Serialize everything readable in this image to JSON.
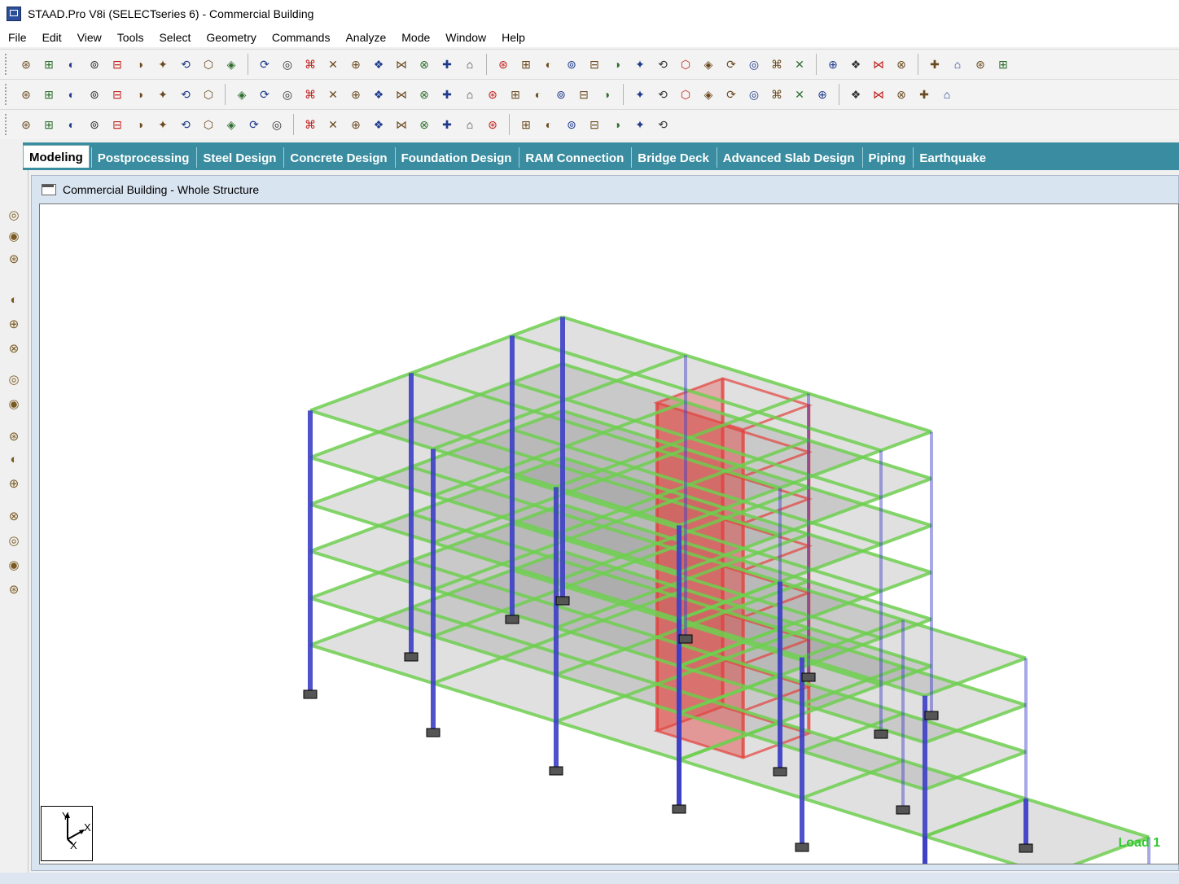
{
  "window": {
    "title": "STAAD.Pro V8i (SELECTseries 6) - Commercial Building"
  },
  "menu": [
    "File",
    "Edit",
    "View",
    "Tools",
    "Select",
    "Geometry",
    "Commands",
    "Analyze",
    "Mode",
    "Window",
    "Help"
  ],
  "tabs": [
    "Modeling",
    "Postprocessing",
    "Steel Design",
    "Concrete Design",
    "Foundation Design",
    "RAM Connection",
    "Bridge Deck",
    "Advanced Slab Design",
    "Piping",
    "Earthquake"
  ],
  "active_tab": "Modeling",
  "document": {
    "title": "Commercial Building - Whole Structure"
  },
  "viewport": {
    "load_label": "Load 1",
    "axis_labels": {
      "y": "Y",
      "x": "X",
      "z": "X"
    }
  },
  "colors": {
    "tab_bar": "#3a8da0",
    "column": "#3d3fc6",
    "beam": "#6fcf50",
    "core": "#e2413c",
    "load_label": "#32c832"
  },
  "icons": {
    "toolbar1": [
      "new-file-icon",
      "open-file-icon",
      "save-icon",
      "print-icon",
      "cut-icon",
      "copy-icon",
      "paste-icon",
      "snap-icon",
      "undo-icon",
      "redo-icon",
      "structure-wizard-icon",
      "zoom-window-icon",
      "zoom-dynamic-icon",
      "view-3d-icon",
      "zoom-in-icon",
      "zoom-out-icon",
      "zoom-extents-icon",
      "zoom-previous-icon",
      "pan-icon",
      "rotate-icon",
      "front-view-icon",
      "back-view-icon",
      "left-view-icon",
      "right-view-icon",
      "top-view-icon",
      "bottom-view-icon",
      "iso-view-icon",
      "rotate-up-icon",
      "rotate-down-icon",
      "spin-left-icon",
      "spin-right-icon",
      "select-all-icon",
      "select-nodes-icon",
      "select-beams-icon",
      "select-plates-icon",
      "select-solids-icon",
      "display-icon",
      "labels-icon",
      "magnify-icon",
      "structure-diagram-icon",
      "scale-icon",
      "render-icon"
    ],
    "toolbar2": [
      "nodes-cursor-icon",
      "beams-cursor-icon",
      "plates-cursor-icon",
      "solids-cursor-icon",
      "surfaces-cursor-icon",
      "geometry-cursor-icon",
      "members-cursor-icon",
      "physical-member-icon",
      "group-icon",
      "add-beam-icon",
      "add-plate-icon",
      "snap-grid-icon",
      "insert-node-icon",
      "connect-beams-icon",
      "intersect-icon",
      "break-beam-icon",
      "stretch-icon",
      "merge-icon",
      "renumber-icon",
      "split-icon",
      "mirror-icon",
      "rotate-geom-icon",
      "translational-repeat-icon",
      "circular-repeat-icon",
      "move-icon",
      "generate-plate-icon",
      "cut-section-icon",
      "dim-beams-icon",
      "show-all-icon",
      "hide-icon",
      "isolate-icon",
      "section-spec-icon",
      "material-icon",
      "constants-icon",
      "support-icon",
      "load-icon",
      "analysis-icon",
      "report-icon",
      "graphs-icon",
      "table-icon"
    ],
    "toolbar3": [
      "rotate-structure-icon",
      "rotate-x-icon",
      "rotate-y-icon",
      "rotate-z-icon",
      "symbol-icon",
      "node-number-icon",
      "beam-number-icon",
      "plate-number-icon",
      "section-icon",
      "orientation-icon",
      "release-icon",
      "offset-icon",
      "beam-spec-icon",
      "plate-spec-icon",
      "node-spec-icon",
      "load-display-icon",
      "deflection-icon",
      "mode-shape-icon",
      "section-forces-icon",
      "stress-icon",
      "contour-icon",
      "animation-icon",
      "dimension-icon",
      "label-icon",
      "node-icon",
      "add-icon",
      "move-node-icon",
      "delete-node-icon"
    ],
    "left": [
      "nodes-tool-icon",
      "beams-tool-icon",
      "plates-tool-icon",
      "general-icon",
      "property-icon",
      "spec-icon",
      "support-tool-icon",
      "loads-tool-icon",
      "material-tool-icon",
      "analysis-tool-icon",
      "output-tool-icon",
      "design-tool-icon",
      "steel-tool-icon",
      "concrete-tool-icon",
      "foundation-tool-icon"
    ]
  }
}
